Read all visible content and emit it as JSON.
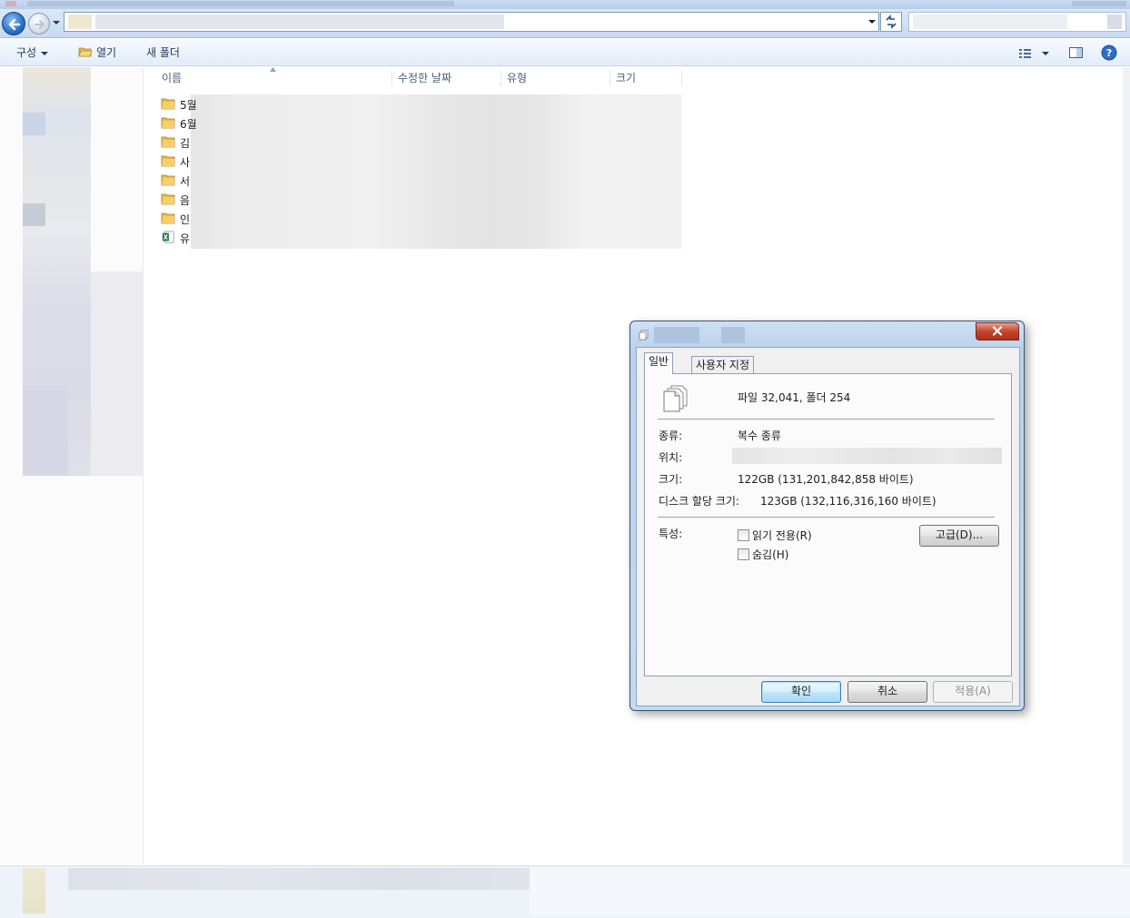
{
  "window": {
    "title_hidden": true
  },
  "address": {
    "path_visible": false
  },
  "toolbar": {
    "organize_label": "구성",
    "open_label": "열기",
    "new_folder_label": "새 폴더"
  },
  "columns": [
    {
      "label": "이름"
    },
    {
      "label": "수정한 날짜"
    },
    {
      "label": "유형"
    },
    {
      "label": "크기"
    }
  ],
  "files": [
    {
      "name": "5월",
      "kind": "folder"
    },
    {
      "name": "6월",
      "kind": "folder"
    },
    {
      "name": "김",
      "kind": "folder"
    },
    {
      "name": "사",
      "kind": "folder"
    },
    {
      "name": "서",
      "kind": "folder"
    },
    {
      "name": "음",
      "kind": "folder"
    },
    {
      "name": "인",
      "kind": "folder"
    },
    {
      "name": "유",
      "kind": "excel-file"
    }
  ],
  "dialog": {
    "tabs": [
      {
        "label": "일반"
      },
      {
        "label": "사용자 지정"
      }
    ],
    "summary": "파일 32,041, 폴더 254",
    "type_label": "종류:",
    "type_value": "복수 종류",
    "location_label": "위치:",
    "size_label": "크기:",
    "size_value": "122GB (131,201,842,858 바이트)",
    "disk_label": "디스크 할당 크기:",
    "disk_value": "123GB (132,116,316,160 바이트)",
    "attributes_label": "특성:",
    "readonly_label": "읽기 전용(R)",
    "hidden_label": "숨김(H)",
    "advanced_button": "고급(D)...",
    "ok_button": "확인",
    "cancel_button": "취소",
    "apply_button": "적용(A)"
  },
  "colors": {
    "accent": "#3c7fb1",
    "close_button": "#c6452e",
    "folder": "#e8b84a",
    "excel": "#1f7a3c"
  }
}
